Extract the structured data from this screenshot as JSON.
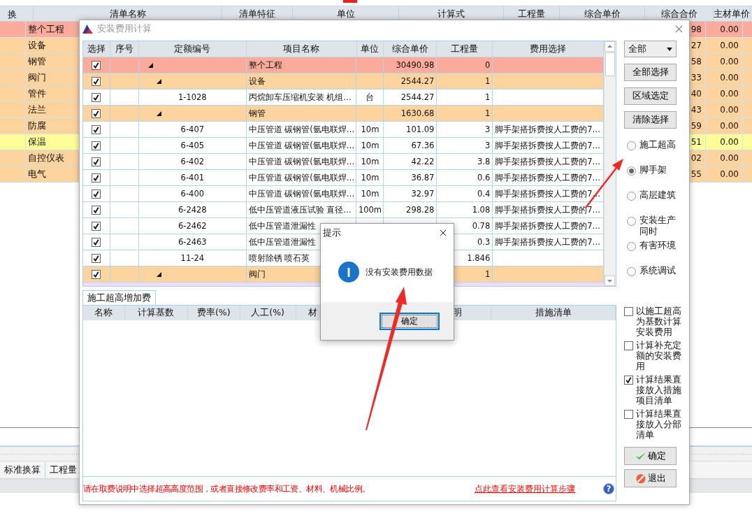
{
  "background_table": {
    "columns": [
      "换",
      "清单名称",
      "清单特征",
      "单位",
      "计算式",
      "工程量",
      "综合单价",
      "综合合价",
      "主材单价"
    ],
    "rows": [
      {
        "kind": "root",
        "name": "整个工程",
        "total": "98",
        "material_price": "0.00"
      },
      {
        "kind": "group",
        "name": "设备",
        "total": "27",
        "material_price": "0.00"
      },
      {
        "kind": "group",
        "name": "钢管",
        "total": "58",
        "material_price": "0.00"
      },
      {
        "kind": "group",
        "name": "阀门",
        "total": "33",
        "material_price": "0.00"
      },
      {
        "kind": "group",
        "name": "管件",
        "total": "40",
        "material_price": "0.00"
      },
      {
        "kind": "group",
        "name": "法兰",
        "total": "43",
        "material_price": "0.00"
      },
      {
        "kind": "group",
        "name": "防腐",
        "total": "59",
        "material_price": "0.00"
      },
      {
        "kind": "highlight",
        "name": "保温",
        "total": "51",
        "material_price": "0.00"
      },
      {
        "kind": "group",
        "name": "自控仪表",
        "total": "02",
        "material_price": "0.00"
      },
      {
        "kind": "group",
        "name": "电气",
        "total": "55",
        "material_price": "0.00"
      }
    ]
  },
  "bottom_tabs": [
    "标准换算",
    "工程量"
  ],
  "dialog": {
    "title": "安装费用计算",
    "grid": {
      "columns": [
        "选择",
        "序号",
        "定额编号",
        "项目名称",
        "单位",
        "综合单价",
        "工程量",
        "费用选择"
      ],
      "rows": [
        {
          "kind": "root",
          "checked": true,
          "expanded": true,
          "name": "整个工程",
          "price": "30490.98",
          "qty": "0",
          "children": [
            {
              "kind": "group",
              "checked": true,
              "expanded": true,
              "name": "设备",
              "price": "2544.27",
              "qty": "1",
              "children": [
                {
                  "kind": "item",
                  "checked": true,
                  "code": "1-1028",
                  "name": "丙烷卸车压缩机安装 机组…",
                  "unit": "台",
                  "price": "2544.27",
                  "qty": "1"
                }
              ]
            },
            {
              "kind": "group",
              "checked": true,
              "expanded": true,
              "name": "钢管",
              "price": "1630.68",
              "qty": "1",
              "children": [
                {
                  "kind": "item",
                  "checked": true,
                  "code": "6-407",
                  "name": "中压管道 碳钢管(氩电联焊…",
                  "unit": "10m",
                  "price": "101.09",
                  "qty": "3",
                  "fee": "脚手架搭拆费按人工费的7…"
                },
                {
                  "kind": "item",
                  "checked": true,
                  "code": "6-405",
                  "name": "中压管道 碳钢管(氩电联焊…",
                  "unit": "10m",
                  "price": "67.36",
                  "qty": "3",
                  "fee": "脚手架搭拆费按人工费的7…"
                },
                {
                  "kind": "item",
                  "checked": true,
                  "code": "6-402",
                  "name": "中压管道 碳钢管(氩电联焊…",
                  "unit": "10m",
                  "price": "42.22",
                  "qty": "3.8",
                  "fee": "脚手架搭拆费按人工费的7…"
                },
                {
                  "kind": "item",
                  "checked": true,
                  "code": "6-401",
                  "name": "中压管道 碳钢管(氩电联焊…",
                  "unit": "10m",
                  "price": "36.87",
                  "qty": "0.6",
                  "fee": "脚手架搭拆费按人工费的7…"
                },
                {
                  "kind": "item",
                  "checked": true,
                  "code": "6-400",
                  "name": "中压管道 碳钢管(氩电联焊…",
                  "unit": "10m",
                  "price": "32.97",
                  "qty": "0.4",
                  "fee": "脚手架搭拆费按人工费的7…"
                },
                {
                  "kind": "item",
                  "checked": true,
                  "code": "6-2428",
                  "name": "低中压管道液压试验 直径…",
                  "unit": "100m",
                  "price": "298.28",
                  "qty": "1.08",
                  "fee": "脚手架搭拆费按人工费的7…"
                },
                {
                  "kind": "item",
                  "checked": true,
                  "code": "6-2462",
                  "name": "低中压管道泄漏性",
                  "qty": "0.78",
                  "fee": "脚手架搭拆费按人工费的7…"
                },
                {
                  "kind": "item",
                  "checked": true,
                  "code": "6-2463",
                  "name": "低中压管道泄漏性",
                  "qty": "0.3",
                  "fee": "脚手架搭拆费按人工费的7…"
                },
                {
                  "kind": "item",
                  "checked": true,
                  "code": "11-24",
                  "name": "喷射除锈 喷石英",
                  "qty": "1.846"
                }
              ]
            },
            {
              "kind": "group",
              "checked": true,
              "expanded": true,
              "name": "阀门",
              "qty": "1",
              "children": [
                {
                  "kind": "cut"
                }
              ]
            }
          ]
        }
      ]
    },
    "filter": "全部",
    "side_buttons": [
      "全部选择",
      "区域选定",
      "清除选择"
    ],
    "options": [
      {
        "label": "施工超高",
        "selected": false
      },
      {
        "label": "脚手架",
        "selected": true
      },
      {
        "label": "高层建筑",
        "selected": false
      },
      {
        "label": "安装生产同时",
        "selected": false
      },
      {
        "label": "有害环境",
        "selected": false
      },
      {
        "label": "系统调试",
        "selected": false
      }
    ],
    "tab": "施工超高增加费",
    "fee_columns": [
      "名称",
      "计算基数",
      "费率(%)",
      "人工(%)",
      "材",
      "明",
      "措施清单"
    ],
    "settings": [
      {
        "label": "以施工超高为基数计算安装费用",
        "checked": false
      },
      {
        "label": "计算补充定额的安装费用",
        "checked": false
      },
      {
        "label": "计算结果直接放入措施项目清单",
        "checked": true
      },
      {
        "label": "计算结果直接放入分部清单",
        "checked": false
      }
    ],
    "ok": "确定",
    "exit": "退出",
    "note": "请在取费说明中选择超高高度范围，或者直接修改费率和工资、材料、机械比例。",
    "link": "点此查看安装费用计算步骤",
    "help": "?"
  },
  "message_box": {
    "title": "提示",
    "message": "没有安装费用数据",
    "button": "确定"
  }
}
